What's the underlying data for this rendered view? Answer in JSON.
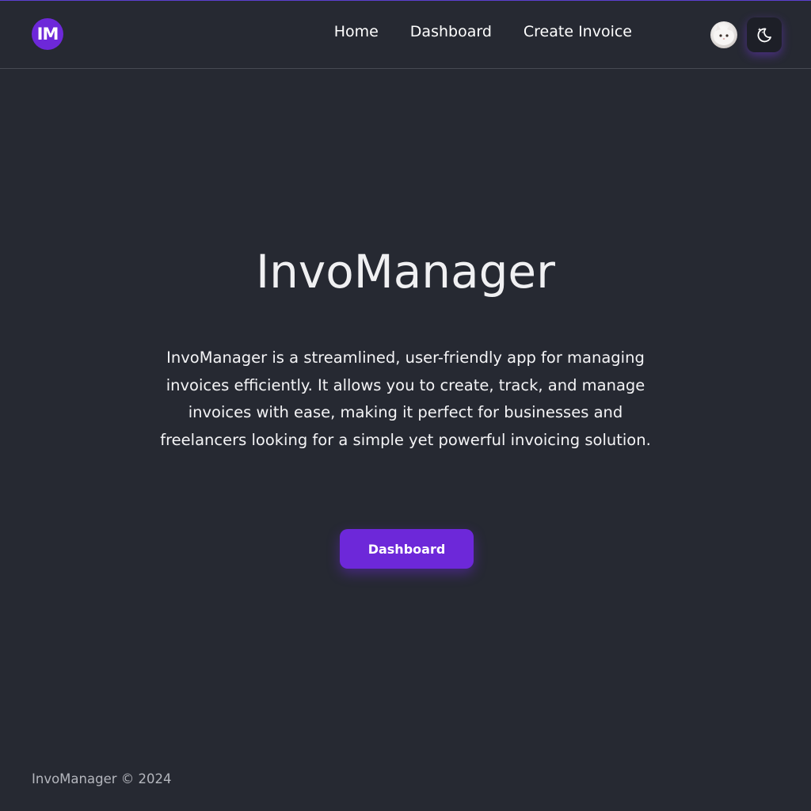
{
  "header": {
    "logo_text": "IM",
    "nav": [
      {
        "label": "Home"
      },
      {
        "label": "Dashboard"
      },
      {
        "label": "Create Invoice"
      }
    ],
    "avatar_icon": "cat-avatar",
    "theme_toggle_icon": "moon-stars-icon"
  },
  "hero": {
    "title": "InvoManager",
    "description": "InvoManager is a streamlined, user-friendly app for managing invoices efficiently. It allows you to create, track, and manage invoices with ease, making it perfect for businesses and freelancers looking for a simple yet powerful invoicing solution.",
    "cta_label": "Dashboard"
  },
  "footer": {
    "text": "InvoManager © 2024"
  },
  "colors": {
    "background": "#262932",
    "accent": "#6d28d9",
    "navbar_border": "#474a53"
  }
}
